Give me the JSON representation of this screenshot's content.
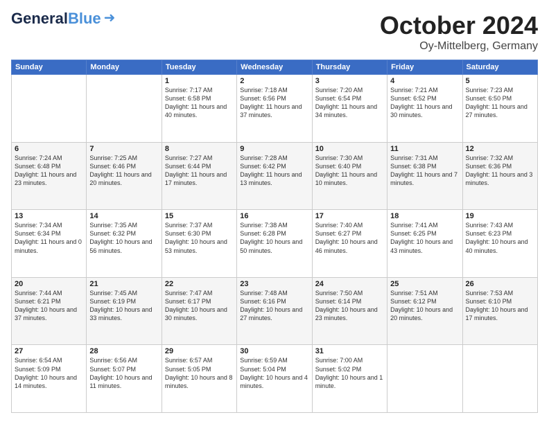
{
  "header": {
    "logo_general": "General",
    "logo_blue": "Blue",
    "month": "October 2024",
    "location": "Oy-Mittelberg, Germany"
  },
  "weekdays": [
    "Sunday",
    "Monday",
    "Tuesday",
    "Wednesday",
    "Thursday",
    "Friday",
    "Saturday"
  ],
  "weeks": [
    [
      {
        "day": "",
        "info": ""
      },
      {
        "day": "",
        "info": ""
      },
      {
        "day": "1",
        "info": "Sunrise: 7:17 AM\nSunset: 6:58 PM\nDaylight: 11 hours and 40 minutes."
      },
      {
        "day": "2",
        "info": "Sunrise: 7:18 AM\nSunset: 6:56 PM\nDaylight: 11 hours and 37 minutes."
      },
      {
        "day": "3",
        "info": "Sunrise: 7:20 AM\nSunset: 6:54 PM\nDaylight: 11 hours and 34 minutes."
      },
      {
        "day": "4",
        "info": "Sunrise: 7:21 AM\nSunset: 6:52 PM\nDaylight: 11 hours and 30 minutes."
      },
      {
        "day": "5",
        "info": "Sunrise: 7:23 AM\nSunset: 6:50 PM\nDaylight: 11 hours and 27 minutes."
      }
    ],
    [
      {
        "day": "6",
        "info": "Sunrise: 7:24 AM\nSunset: 6:48 PM\nDaylight: 11 hours and 23 minutes."
      },
      {
        "day": "7",
        "info": "Sunrise: 7:25 AM\nSunset: 6:46 PM\nDaylight: 11 hours and 20 minutes."
      },
      {
        "day": "8",
        "info": "Sunrise: 7:27 AM\nSunset: 6:44 PM\nDaylight: 11 hours and 17 minutes."
      },
      {
        "day": "9",
        "info": "Sunrise: 7:28 AM\nSunset: 6:42 PM\nDaylight: 11 hours and 13 minutes."
      },
      {
        "day": "10",
        "info": "Sunrise: 7:30 AM\nSunset: 6:40 PM\nDaylight: 11 hours and 10 minutes."
      },
      {
        "day": "11",
        "info": "Sunrise: 7:31 AM\nSunset: 6:38 PM\nDaylight: 11 hours and 7 minutes."
      },
      {
        "day": "12",
        "info": "Sunrise: 7:32 AM\nSunset: 6:36 PM\nDaylight: 11 hours and 3 minutes."
      }
    ],
    [
      {
        "day": "13",
        "info": "Sunrise: 7:34 AM\nSunset: 6:34 PM\nDaylight: 11 hours and 0 minutes."
      },
      {
        "day": "14",
        "info": "Sunrise: 7:35 AM\nSunset: 6:32 PM\nDaylight: 10 hours and 56 minutes."
      },
      {
        "day": "15",
        "info": "Sunrise: 7:37 AM\nSunset: 6:30 PM\nDaylight: 10 hours and 53 minutes."
      },
      {
        "day": "16",
        "info": "Sunrise: 7:38 AM\nSunset: 6:28 PM\nDaylight: 10 hours and 50 minutes."
      },
      {
        "day": "17",
        "info": "Sunrise: 7:40 AM\nSunset: 6:27 PM\nDaylight: 10 hours and 46 minutes."
      },
      {
        "day": "18",
        "info": "Sunrise: 7:41 AM\nSunset: 6:25 PM\nDaylight: 10 hours and 43 minutes."
      },
      {
        "day": "19",
        "info": "Sunrise: 7:43 AM\nSunset: 6:23 PM\nDaylight: 10 hours and 40 minutes."
      }
    ],
    [
      {
        "day": "20",
        "info": "Sunrise: 7:44 AM\nSunset: 6:21 PM\nDaylight: 10 hours and 37 minutes."
      },
      {
        "day": "21",
        "info": "Sunrise: 7:45 AM\nSunset: 6:19 PM\nDaylight: 10 hours and 33 minutes."
      },
      {
        "day": "22",
        "info": "Sunrise: 7:47 AM\nSunset: 6:17 PM\nDaylight: 10 hours and 30 minutes."
      },
      {
        "day": "23",
        "info": "Sunrise: 7:48 AM\nSunset: 6:16 PM\nDaylight: 10 hours and 27 minutes."
      },
      {
        "day": "24",
        "info": "Sunrise: 7:50 AM\nSunset: 6:14 PM\nDaylight: 10 hours and 23 minutes."
      },
      {
        "day": "25",
        "info": "Sunrise: 7:51 AM\nSunset: 6:12 PM\nDaylight: 10 hours and 20 minutes."
      },
      {
        "day": "26",
        "info": "Sunrise: 7:53 AM\nSunset: 6:10 PM\nDaylight: 10 hours and 17 minutes."
      }
    ],
    [
      {
        "day": "27",
        "info": "Sunrise: 6:54 AM\nSunset: 5:09 PM\nDaylight: 10 hours and 14 minutes."
      },
      {
        "day": "28",
        "info": "Sunrise: 6:56 AM\nSunset: 5:07 PM\nDaylight: 10 hours and 11 minutes."
      },
      {
        "day": "29",
        "info": "Sunrise: 6:57 AM\nSunset: 5:05 PM\nDaylight: 10 hours and 8 minutes."
      },
      {
        "day": "30",
        "info": "Sunrise: 6:59 AM\nSunset: 5:04 PM\nDaylight: 10 hours and 4 minutes."
      },
      {
        "day": "31",
        "info": "Sunrise: 7:00 AM\nSunset: 5:02 PM\nDaylight: 10 hours and 1 minute."
      },
      {
        "day": "",
        "info": ""
      },
      {
        "day": "",
        "info": ""
      }
    ]
  ]
}
